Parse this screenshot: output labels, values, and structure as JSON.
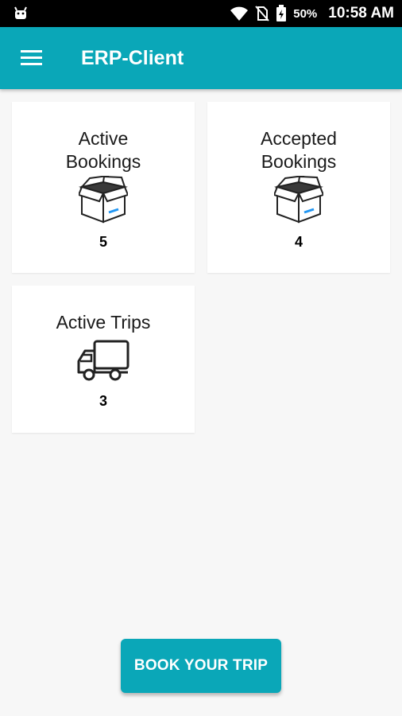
{
  "status_bar": {
    "battery": "50%",
    "time": "10:58 AM",
    "icons": [
      "android-icon",
      "wifi-icon",
      "no-sim-icon",
      "battery-charging-icon"
    ]
  },
  "app_bar": {
    "title": "ERP-Client",
    "menu_icon": "hamburger-menu-icon",
    "color": "#0aa7b8"
  },
  "cards": [
    {
      "title": "Active\nBookings",
      "count": "5",
      "icon": "open-box-icon"
    },
    {
      "title": "Accepted\nBookings",
      "count": "4",
      "icon": "open-box-icon"
    },
    {
      "title": "Active Trips",
      "count": "3",
      "icon": "truck-icon"
    }
  ],
  "book_button": {
    "label": "BOOK YOUR TRIP",
    "color": "#0aa7b8"
  }
}
